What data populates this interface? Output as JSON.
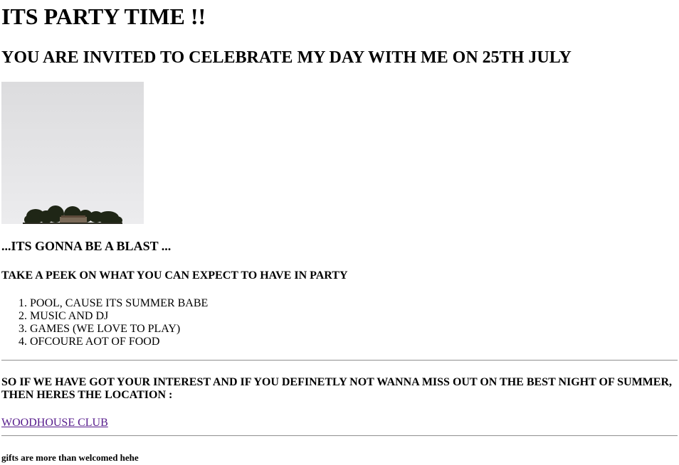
{
  "page": {
    "title": "ITS PARTY TIME !!",
    "subtitle": "YOU ARE INVITED TO CELEBRATE MY DAY WITH ME ON 25TH JULY",
    "image_icon": "sky-trees-photo",
    "blast_heading": "...ITS GONNA BE A BLAST ...",
    "peek_heading": "TAKE A PEEK ON WHAT YOU CAN EXPECT TO HAVE IN PARTY",
    "expect_list": [
      "POOL, CAUSE ITS SUMMER BABE",
      "MUSIC AND DJ",
      "GAMES (WE LOVE TO PLAY)",
      "OFCOURE AOT OF FOOD"
    ],
    "interest_text": "SO IF WE HAVE GOT YOUR INTEREST AND IF YOU DEFINETLY NOT WANNA MISS OUT ON THE BEST NIGHT OF SUMMER, THEN HERES THE LOCATION :",
    "location_link": "WOODHOUSE CLUB",
    "gifts_note": "gifts are more than welcomed hehe"
  },
  "colors": {
    "text": "#000000",
    "visited_link": "#551a8b",
    "rule": "#9a9a9a",
    "sky": "#e4e4e6"
  }
}
